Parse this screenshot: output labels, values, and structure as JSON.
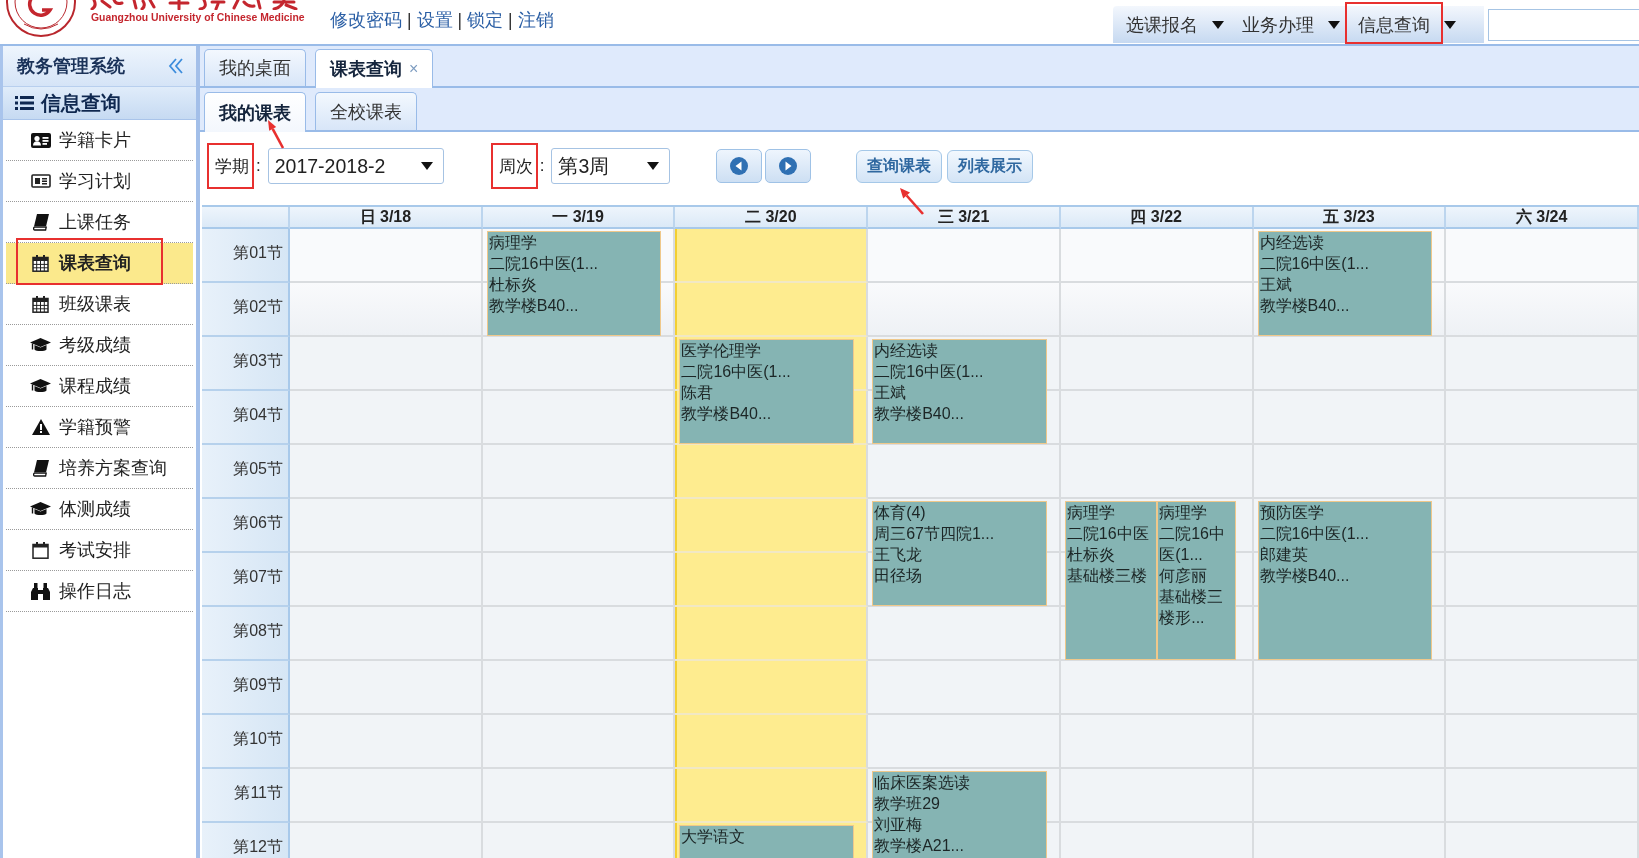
{
  "header": {
    "logo_text": "Guangzhou University of Chinese Medicine",
    "links": [
      "修改密码",
      "设置",
      "锁定",
      "注销"
    ],
    "separator": "|",
    "menu": [
      {
        "label": "选课报名",
        "annotated": false
      },
      {
        "label": "业务办理",
        "annotated": false
      },
      {
        "label": "信息查询",
        "annotated": true
      }
    ]
  },
  "sidebar": {
    "title": "教务管理系统",
    "section": "信息查询",
    "items": [
      {
        "label": "学籍卡片",
        "selected": false,
        "annotated": false
      },
      {
        "label": "学习计划",
        "selected": false,
        "annotated": false
      },
      {
        "label": "上课任务",
        "selected": false,
        "annotated": false
      },
      {
        "label": "课表查询",
        "selected": true,
        "annotated": true
      },
      {
        "label": "班级课表",
        "selected": false,
        "annotated": false
      },
      {
        "label": "考级成绩",
        "selected": false,
        "annotated": false
      },
      {
        "label": "课程成绩",
        "selected": false,
        "annotated": false
      },
      {
        "label": "学籍预警",
        "selected": false,
        "annotated": false
      },
      {
        "label": "培养方案查询",
        "selected": false,
        "annotated": false
      },
      {
        "label": "体测成绩",
        "selected": false,
        "annotated": false
      },
      {
        "label": "考试安排",
        "selected": false,
        "annotated": false
      },
      {
        "label": "操作日志",
        "selected": false,
        "annotated": false
      }
    ]
  },
  "tabs": [
    {
      "label": "我的桌面",
      "selected": false
    },
    {
      "label": "课表查询",
      "selected": true,
      "close": "×"
    }
  ],
  "subtabs": [
    {
      "label": "我的课表",
      "selected": true,
      "annotation_arrow": true
    },
    {
      "label": "全校课表",
      "selected": false,
      "annotation_arrow": false
    }
  ],
  "toolbar": {
    "term": {
      "label": "学期",
      "suffix": ":",
      "value": "2017-2018-2",
      "annotated": true
    },
    "week": {
      "label": "周次",
      "suffix": ":",
      "value": "第3周",
      "annotated": true
    },
    "buttons": [
      {
        "label": "查询课表",
        "annotation_arrow": true
      },
      {
        "label": "列表展示",
        "annotation_arrow": false
      }
    ]
  },
  "timetable": {
    "periods": [
      "第01节",
      "第02节",
      "第03节",
      "第04节",
      "第05节",
      "第06节",
      "第07节",
      "第08节",
      "第09节",
      "第10节",
      "第11节",
      "第12节"
    ],
    "days": [
      {
        "label": "日 3/18",
        "today": false
      },
      {
        "label": "一 3/19",
        "today": false,
        "slots": [
          {
            "kind": "start",
            "courses": [
              {
                "course": "病理学",
                "class": "二院16中医(1...",
                "teacher": "杜标炎",
                "room": "教学楼B40..."
              }
            ]
          },
          {
            "kind": "continued"
          }
        ]
      },
      {
        "label": "二 3/20",
        "today": true,
        "slots": [
          {
            "kind": "free"
          },
          {
            "kind": "free"
          },
          {
            "kind": "start",
            "courses": [
              {
                "course": "医学伦理学",
                "class": "二院16中医(1...",
                "teacher": "陈君",
                "room": "教学楼B40..."
              }
            ]
          },
          {
            "kind": "continued"
          },
          {
            "kind": "free"
          },
          {
            "kind": "free"
          },
          {
            "kind": "free"
          },
          {
            "kind": "free"
          },
          {
            "kind": "free"
          },
          {
            "kind": "free"
          },
          {
            "kind": "free"
          },
          {
            "kind": "start",
            "courses": [
              {
                "course": "大学语文"
              }
            ]
          }
        ]
      },
      {
        "label": "三 3/21",
        "today": false,
        "slots": [
          {
            "kind": "free"
          },
          {
            "kind": "free"
          },
          {
            "kind": "start",
            "courses": [
              {
                "course": "内经选读",
                "class": "二院16中医(1...",
                "teacher": "王斌",
                "room": "教学楼B40..."
              }
            ]
          },
          {
            "kind": "continued"
          },
          {
            "kind": "free"
          },
          {
            "kind": "start",
            "courses": [
              {
                "course": "体育(4)",
                "class": "周三67节四院1...",
                "teacher": "王飞龙",
                "room": "田径场"
              }
            ]
          },
          {
            "kind": "continued"
          },
          {
            "kind": "free"
          },
          {
            "kind": "free"
          },
          {
            "kind": "free"
          },
          {
            "kind": "start",
            "courses": [
              {
                "course": "临床医案选读",
                "class": "教学班29",
                "teacher": "刘亚梅",
                "room": "教学楼A21..."
              }
            ]
          },
          {
            "kind": "continued"
          }
        ]
      },
      {
        "label": "四 3/22",
        "today": false,
        "slots": [
          {
            "kind": "free"
          },
          {
            "kind": "free"
          },
          {
            "kind": "free"
          },
          {
            "kind": "free"
          },
          {
            "kind": "free"
          },
          {
            "kind": "start",
            "courses": [
              {
                "course": "病理学",
                "class": "二院16中医",
                "teacher": "杜标炎",
                "room": "基础楼三楼"
              },
              {
                "course": "病理学",
                "class": "二院16中医(1...",
                "teacher": "何彦丽",
                "room": "基础楼三楼形..."
              }
            ]
          },
          {
            "kind": "continued"
          },
          {
            "kind": "continued"
          }
        ]
      },
      {
        "label": "五 3/23",
        "today": false,
        "slots": [
          {
            "kind": "start",
            "courses": [
              {
                "course": "内经选读",
                "class": "二院16中医(1...",
                "teacher": "王斌",
                "room": "教学楼B40..."
              }
            ]
          },
          {
            "kind": "continued"
          },
          {
            "kind": "free"
          },
          {
            "kind": "free"
          },
          {
            "kind": "free"
          },
          {
            "kind": "start",
            "courses": [
              {
                "course": "预防医学",
                "class": "二院16中医(1...",
                "teacher": "郎建英",
                "room": "教学楼B40..."
              }
            ]
          },
          {
            "kind": "continued"
          },
          {
            "kind": "continued"
          }
        ]
      },
      {
        "label": "六 3/24",
        "today": false
      }
    ]
  }
}
